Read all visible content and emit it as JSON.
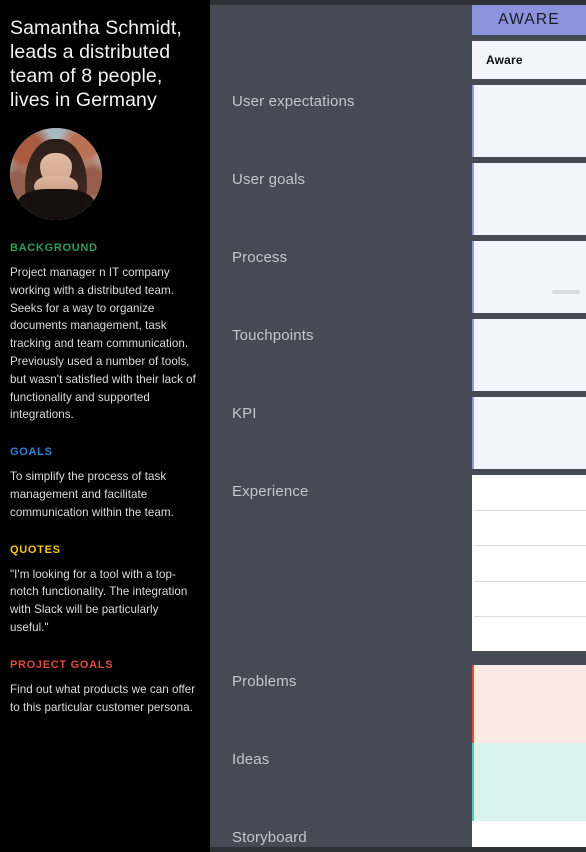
{
  "theme": {
    "sidebar_bg": "#000000",
    "panel_bg": "#454a54",
    "app_bg": "#2e3238",
    "accent_aware": "#8b93dd",
    "cell_bg": "#f4f4fd",
    "problems_bg": "#fdeae6",
    "problems_border": "#e8453c",
    "ideas_bg": "#d8f3ec",
    "ideas_border": "#4ecdb0",
    "heading_background": "#2e9e5b",
    "heading_goals": "#2f80d8",
    "heading_quotes": "#f5c518",
    "heading_project_goals": "#e04b3a"
  },
  "sidebar": {
    "persona_title": "Samantha Schmidt, leads a distributed team of 8 people, lives in Germany",
    "avatar_name": "avatar",
    "sections": [
      {
        "heading": "BACKGROUND",
        "body": "Project manager n IT company working with a distributed team.\nSeeks for a way to organize documents management, task tracking and team communication. Previously used a number of tools, but wasn't satisfied with their lack of functionality and supported integrations."
      },
      {
        "heading": "GOALS",
        "body": "To simplify the process of task management and facilitate communication within the team."
      },
      {
        "heading": "QUOTES",
        "body": "\"I'm looking for a tool with a top-notch functionality. The integration with Slack will be particularly useful.\""
      },
      {
        "heading": "PROJECT GOALS",
        "body": "Find out what products we can offer to this particular customer persona."
      }
    ]
  },
  "journey_map": {
    "stage_header": "AWARE",
    "stage_chip": "Aware",
    "rows": [
      {
        "label": "",
        "name": "stage-header-row",
        "cell_kind": "header",
        "content": ""
      },
      {
        "label": "",
        "name": "stage-chip-row",
        "cell_kind": "chip",
        "content": "Aware"
      },
      {
        "label": "User expectations",
        "name": "row-user-expectations",
        "cell_kind": "lavender",
        "content": ""
      },
      {
        "label": "User goals",
        "name": "row-user-goals",
        "cell_kind": "lavender",
        "content": ""
      },
      {
        "label": "Process",
        "name": "row-process",
        "cell_kind": "lavender",
        "content": ""
      },
      {
        "label": "Touchpoints",
        "name": "row-touchpoints",
        "cell_kind": "lavender",
        "content": ""
      },
      {
        "label": "KPI",
        "name": "row-kpi",
        "cell_kind": "lavender",
        "content": ""
      },
      {
        "label": "Experience",
        "name": "row-experience",
        "cell_kind": "white-subrows",
        "subrows": 5,
        "content": ""
      },
      {
        "label": "Problems",
        "name": "row-problems",
        "cell_kind": "problems",
        "content": ""
      },
      {
        "label": "Ideas",
        "name": "row-ideas",
        "cell_kind": "ideas",
        "content": ""
      },
      {
        "label": "Storyboard",
        "name": "row-storyboard",
        "cell_kind": "plain-white",
        "content": ""
      }
    ]
  }
}
